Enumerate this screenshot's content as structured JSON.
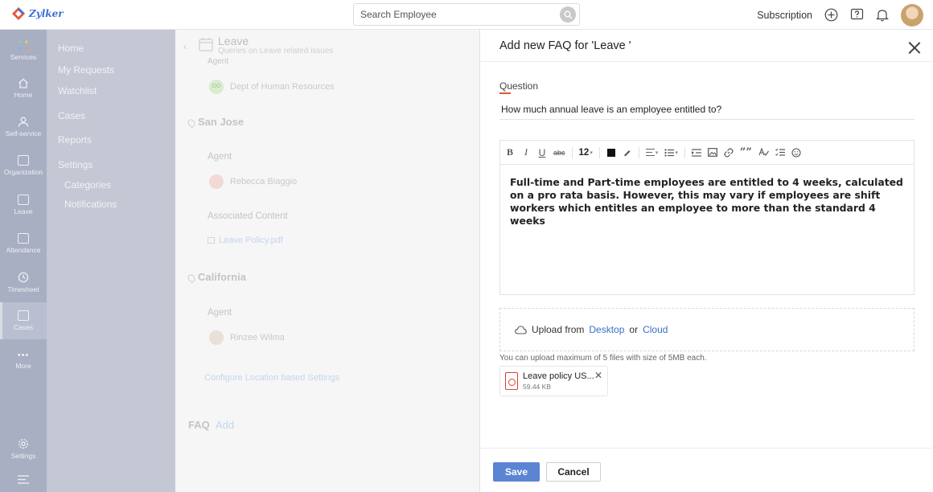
{
  "brand": {
    "logo_text": "Zylker"
  },
  "search": {
    "placeholder": "Search Employee"
  },
  "header": {
    "subscription_label": "Subscription"
  },
  "rail": {
    "items": [
      {
        "label": "Services"
      },
      {
        "label": "Home"
      },
      {
        "label": "Self-service"
      },
      {
        "label": "Organization"
      },
      {
        "label": "Leave"
      },
      {
        "label": "Attendance"
      },
      {
        "label": "Timesheet"
      },
      {
        "label": "Cases"
      },
      {
        "label": "More"
      },
      {
        "label": "Settings"
      }
    ]
  },
  "subnav": {
    "items": [
      {
        "label": "Home"
      },
      {
        "label": "My Requests"
      },
      {
        "label": "Watchlist"
      },
      {
        "label": "Cases"
      },
      {
        "label": "Reports"
      },
      {
        "label": "Settings"
      }
    ],
    "sub_items": [
      {
        "label": "Categories"
      },
      {
        "label": "Notifications"
      }
    ]
  },
  "main": {
    "category_title": "Leave",
    "category_subtitle": "Queries on Leave related issues",
    "agent_label": "Agent",
    "dept_agent": "Dept of Human Resources",
    "dept_initials": "DO",
    "locations": [
      {
        "name": "San Jose",
        "agent_label": "Agent",
        "agent": "Rebecca Biaggio",
        "content_label": "Associated Content",
        "content": "Leave Policy.pdf"
      },
      {
        "name": "California",
        "agent_label": "Agent",
        "agent": "Rinzee Wilma"
      }
    ],
    "configure_link": "Configure Location based Settings",
    "faq_label": "FAQ",
    "faq_add": "Add"
  },
  "panel": {
    "title": "Add new FAQ for 'Leave '",
    "question_label": "Question",
    "question_value": "How much annual leave is an employee entitled to?",
    "toolbar": {
      "bold": "B",
      "italic": "I",
      "underline": "U",
      "strike": "abc",
      "font_size": "12",
      "quote": "””",
      "spell": "A̶"
    },
    "answer": "Full-time and Part-time employees are entitled to 4 weeks, calculated on a pro rata basis.  However, this may vary if employees are shift workers which entitles an employee to more than the standard 4 weeks",
    "upload": {
      "prefix": "Upload from",
      "desktop": "Desktop",
      "or": "or",
      "cloud": "Cloud",
      "hint": "You can upload maximum of 5 files with size of 5MB each."
    },
    "attachment": {
      "name": "Leave policy US...",
      "size": "59.44 KB"
    },
    "save_label": "Save",
    "cancel_label": "Cancel"
  }
}
